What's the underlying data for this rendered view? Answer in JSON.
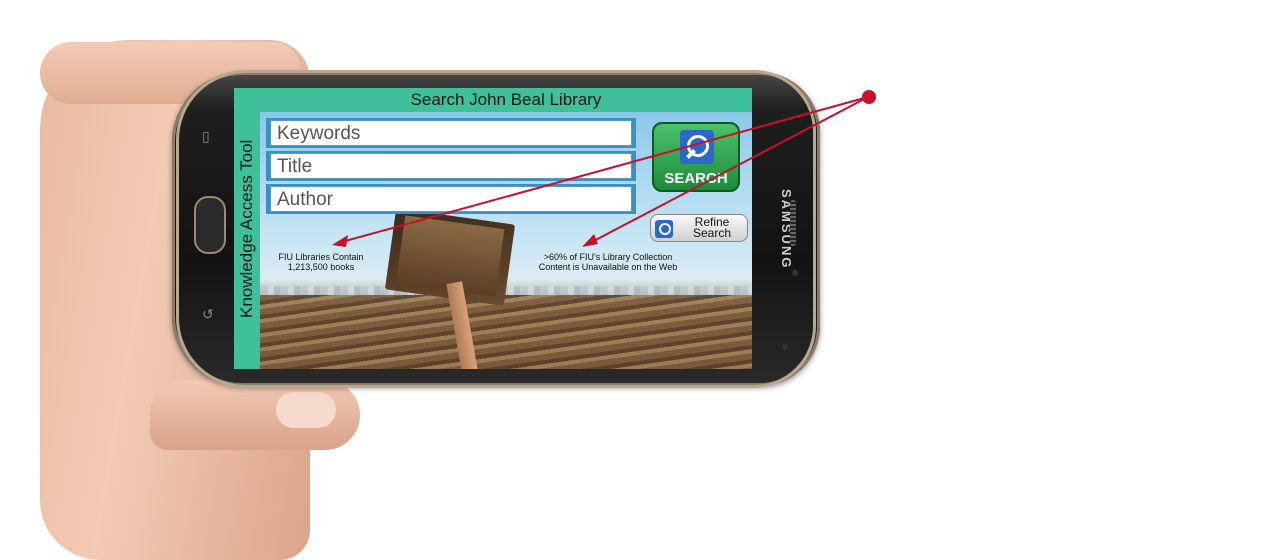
{
  "app": {
    "side_title": "Knowledge Access Tool",
    "header_title": "Search John Beal Library"
  },
  "search_form": {
    "keywords_placeholder": "Keywords",
    "title_placeholder": "Title",
    "author_placeholder": "Author",
    "search_button_label": "SEARCH",
    "refine_button_label": "Refine Search"
  },
  "captions": {
    "left": "FIU Libraries Contain\n1,213,500 books",
    "right": ">60% of FIU's Library Collection\nContent is Unavailable on the Web"
  },
  "device": {
    "brand": "SAMSUNG"
  },
  "colors": {
    "accent_green": "#3fbf9a",
    "field_blue": "#3b8fc3",
    "search_button": "#2aa34a",
    "annotation_red": "#c8102e"
  }
}
